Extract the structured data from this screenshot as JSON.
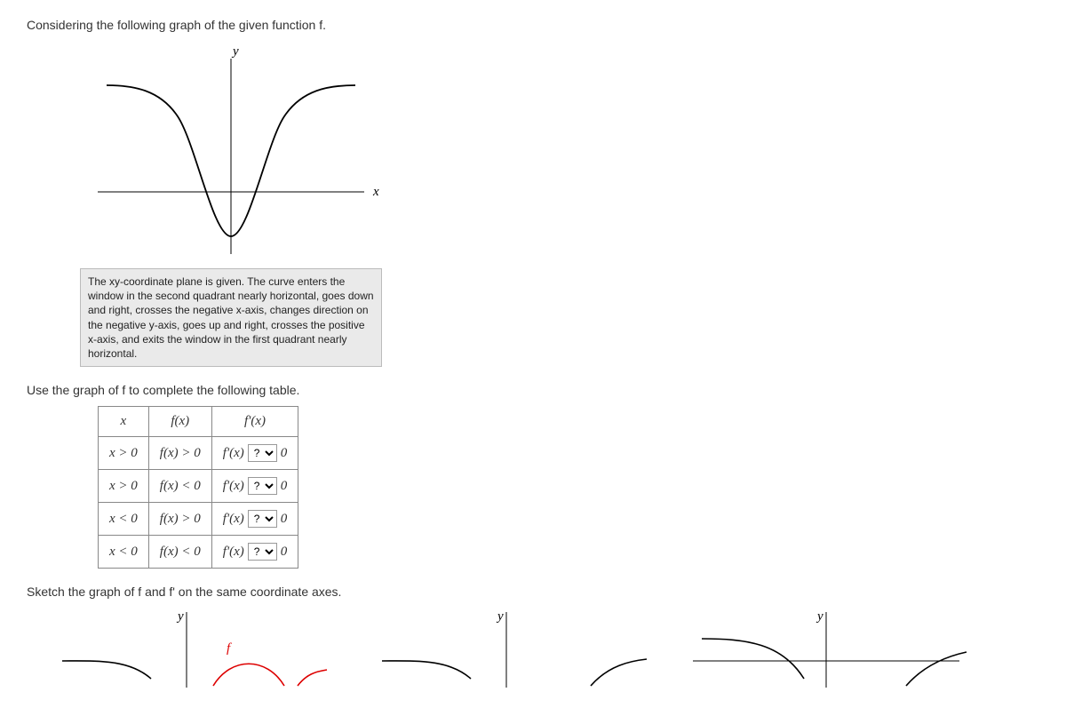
{
  "intro_text": "Considering the following graph of the given function f.",
  "axis_x": "x",
  "axis_y": "y",
  "description": "The xy-coordinate plane is given. The curve enters the window in the second quadrant nearly horizontal, goes down and right, crosses the negative x-axis, changes direction on the negative y-axis, goes up and right, crosses the positive x-axis, and exits the window in the first quadrant nearly horizontal.",
  "table_instruction": "Use the graph of f to complete the following table.",
  "table": {
    "headers": {
      "c1": "x",
      "c2": "f(x)",
      "c3": "f'(x)"
    },
    "rows": [
      {
        "x": "x > 0",
        "fx": "f(x) > 0",
        "fpx_pre": "f'(x)",
        "zero": "0"
      },
      {
        "x": "x > 0",
        "fx": "f(x) < 0",
        "fpx_pre": "f'(x)",
        "zero": "0"
      },
      {
        "x": "x < 0",
        "fx": "f(x) > 0",
        "fpx_pre": "f'(x)",
        "zero": "0"
      },
      {
        "x": "x < 0",
        "fx": "f(x) < 0",
        "fpx_pre": "f'(x)",
        "zero": "0"
      }
    ],
    "select_placeholder": "?"
  },
  "sketch_instruction": "Sketch the graph of f and f' on the same coordinate axes.",
  "mini_y": "y",
  "f_label": "f",
  "chart_data": {
    "type": "line",
    "title": "",
    "xlabel": "x",
    "ylabel": "y",
    "description": "Curve resembling an upward-opening shape: enters from upper-left nearly horizontal, descends through negative x-axis, reaches minimum on negative y-axis at x=0, ascends through positive x-axis, exits upper-right nearly horizontal.",
    "x": [
      -3,
      -2,
      -1.2,
      -0.6,
      0,
      0.6,
      1.2,
      2,
      3
    ],
    "y": [
      2.3,
      2.2,
      1.4,
      -0.6,
      -1.8,
      -0.6,
      1.4,
      2.2,
      2.3
    ],
    "xlim": [
      -3.2,
      3.2
    ],
    "ylim": [
      -2.2,
      2.6
    ]
  }
}
